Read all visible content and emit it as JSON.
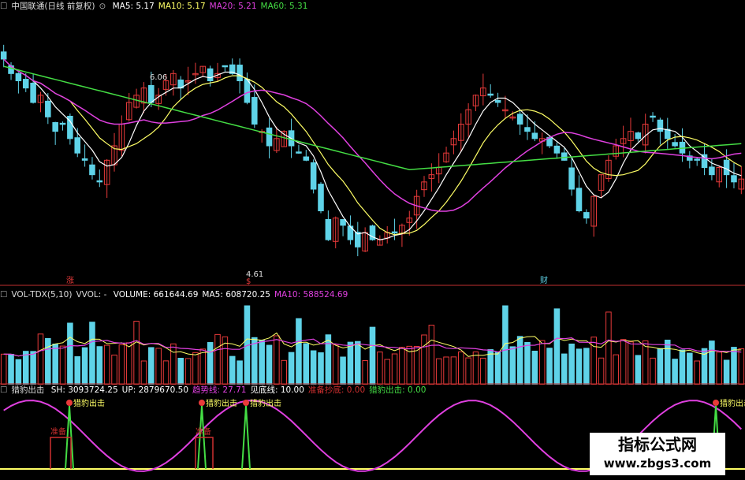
{
  "header_price": {
    "name": "中国联通(日线 前复权)",
    "items": [
      {
        "label": "MA5:",
        "value": "5.17",
        "color": "#ffffff"
      },
      {
        "label": "MA10:",
        "value": "5.17",
        "color": "#ffff66"
      },
      {
        "label": "MA20:",
        "value": "5.21",
        "color": "#e040e0"
      },
      {
        "label": "MA60:",
        "value": "5.31",
        "color": "#44dd44"
      }
    ]
  },
  "header_volume": {
    "name": "VOL-TDX(5,10)",
    "vvol": "VVOL: -",
    "items": [
      {
        "label": "VOLUME:",
        "value": "661644.69",
        "color": "#ffffff"
      },
      {
        "label": "MA5:",
        "value": "608720.25",
        "color": "#ffffff"
      },
      {
        "label": "MA10:",
        "value": "588524.69",
        "color": "#e040e0"
      }
    ]
  },
  "header_indicator": {
    "name": "猎豹出击",
    "items": [
      {
        "label": "SH:",
        "value": "3093724.25",
        "color": "#ffffff"
      },
      {
        "label": "UP:",
        "value": "2879670.50",
        "color": "#ffffff"
      },
      {
        "label": "趋势线:",
        "value": "27.71",
        "color": "#e040e0"
      },
      {
        "label": "见底线:",
        "value": "10.00",
        "color": "#ffffff"
      },
      {
        "label": "准备抄底:",
        "value": "0.00",
        "color": "#d03030"
      },
      {
        "label": "猎豹出击:",
        "value": "0.00",
        "color": "#44dd44"
      }
    ]
  },
  "annotations": {
    "high_label": "6.06",
    "low_label": "4.61",
    "marker_zhang": "涨",
    "marker_s": "$",
    "marker_cai": "财",
    "signal_label": "猎豹出击",
    "prepare_label": "准备"
  },
  "watermark": {
    "line1": "指标公式网",
    "line2": "www.zbgs3.com"
  },
  "colors": {
    "up": "#e83a3a",
    "down": "#5fd3e8",
    "ma5": "#ffffff",
    "ma10": "#ffff66",
    "ma20": "#e040e0",
    "ma60": "#44dd44",
    "trend": "#e040e0",
    "bottom_line": "#ffff66",
    "signal": "#44dd44",
    "separator": "#c03030"
  },
  "chart_data": {
    "type": "candlestick",
    "price_axis_estimate": [
      4.5,
      6.3
    ],
    "close": [
      6.0,
      5.9,
      5.85,
      5.8,
      5.7,
      5.75,
      5.6,
      5.5,
      5.55,
      5.45,
      5.35,
      5.3,
      5.2,
      5.15,
      5.3,
      5.4,
      5.55,
      5.7,
      5.75,
      5.8,
      5.7,
      5.75,
      5.85,
      5.9,
      5.8,
      5.85,
      5.9,
      5.95,
      5.85,
      5.9,
      5.95,
      5.9,
      5.85,
      5.7,
      5.55,
      5.5,
      5.4,
      5.45,
      5.5,
      5.4,
      5.35,
      5.3,
      5.1,
      4.95,
      4.75,
      4.9,
      4.85,
      4.75,
      4.7,
      4.8,
      4.75,
      4.75,
      4.8,
      4.8,
      4.85,
      4.9,
      5.05,
      5.15,
      5.2,
      5.25,
      5.35,
      5.45,
      5.55,
      5.65,
      5.75,
      5.8,
      5.75,
      5.7,
      5.65,
      5.6,
      5.55,
      5.5,
      5.45,
      5.45,
      5.4,
      5.35,
      5.3,
      5.1,
      4.95,
      4.9,
      5.05,
      5.2,
      5.3,
      5.4,
      5.45,
      5.5,
      5.45,
      5.55,
      5.6,
      5.5,
      5.45,
      5.4,
      5.35,
      5.3,
      5.3,
      5.25,
      5.2,
      5.25,
      5.2,
      5.15,
      5.17
    ],
    "volume_scale_estimate": "relative",
    "indicator_axis_estimate": [
      0,
      100
    ]
  }
}
